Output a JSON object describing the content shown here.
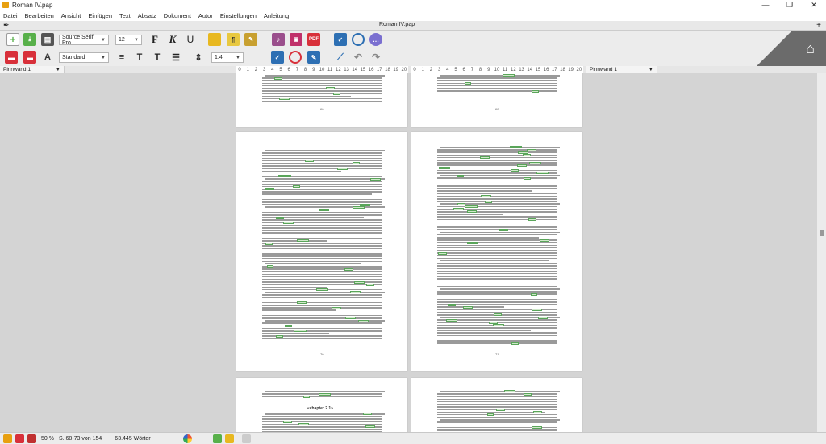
{
  "window": {
    "title": "Roman IV.pap",
    "minimize": "—",
    "maximize": "❐",
    "close": "✕"
  },
  "menu": [
    "Datei",
    "Bearbeiten",
    "Ansicht",
    "Einfügen",
    "Text",
    "Absatz",
    "Dokument",
    "Autor",
    "Einstellungen",
    "Anleitung"
  ],
  "tab": {
    "label": "Roman IV.pap",
    "new_tab": "+",
    "quill": "✒"
  },
  "toolbar": {
    "font_family": "Source Serif Pro",
    "font_size": "12",
    "bold": "F",
    "italic": "K",
    "underline": "U",
    "paragraph_style": "Standard",
    "line_spacing": "1.4",
    "colors": {
      "new": "#58b04a",
      "save": "#d8303a",
      "folder": "#e8b820",
      "accent": "#2d6fb3"
    }
  },
  "pinnwand": {
    "left": "Pinnwand 1",
    "right": "Pinnwand 1"
  },
  "ruler": {
    "left": [
      "0",
      "1",
      "2",
      "3",
      "4",
      "5",
      "6",
      "7",
      "8",
      "9",
      "10",
      "11",
      "12",
      "13",
      "14",
      "15",
      "16",
      "17",
      "18",
      "19",
      "20"
    ],
    "right": [
      "0",
      "1",
      "2",
      "3",
      "4",
      "5",
      "6",
      "7",
      "8",
      "9",
      "10",
      "11",
      "12",
      "13",
      "14",
      "15",
      "16",
      "17",
      "18",
      "19",
      "20"
    ]
  },
  "pages": {
    "p1_num": "69",
    "p2_num": "69",
    "p3_num": "70",
    "p4_num": "71",
    "chapter": "«chapter 2.1»"
  },
  "status": {
    "zoom": "50 %",
    "pages": "S. 68-73 von 154",
    "words": "63.445 Wörter"
  }
}
